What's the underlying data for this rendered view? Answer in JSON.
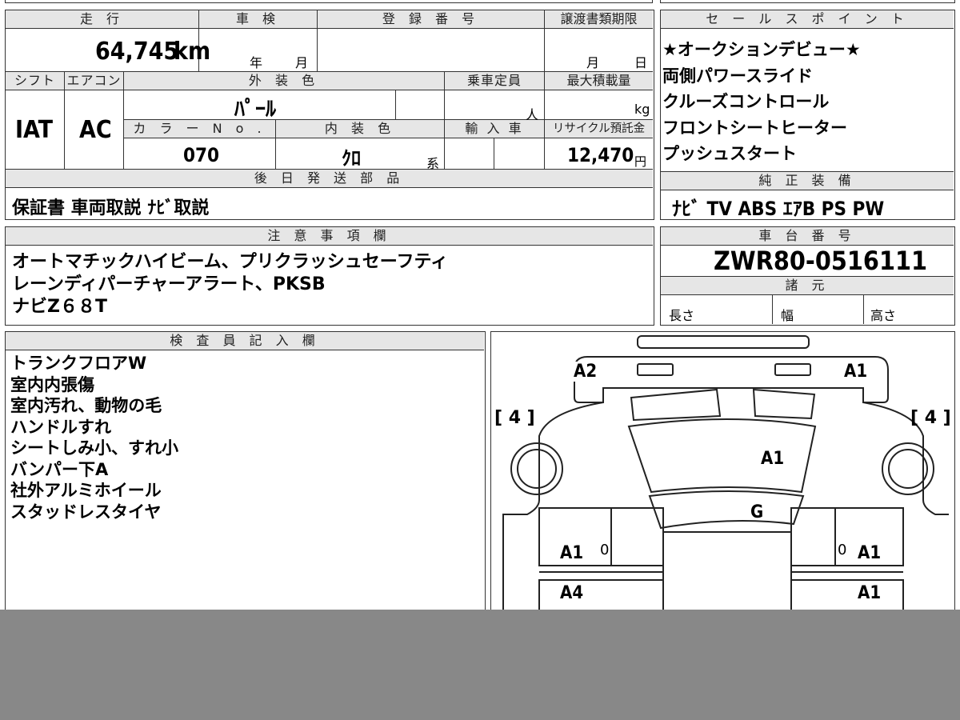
{
  "mileage": {
    "header": "走 行",
    "value": "64,745",
    "unit": "km"
  },
  "inspection": {
    "header": "車 検",
    "year": "年",
    "month": "月"
  },
  "registration": {
    "header": "登 録 番 号"
  },
  "transfer": {
    "header": "譲渡書類期限",
    "month": "月",
    "day": "日"
  },
  "sales_points": {
    "header": "セ ー ル ス ポ イ ン ト",
    "items": [
      "★オークションデビュー★",
      "両側パワースライド",
      "クルーズコントロール",
      "フロントシートヒーター",
      "プッシュスタート"
    ]
  },
  "shift": {
    "header": "シフト",
    "value": "IAT"
  },
  "aircon": {
    "header": "エアコン",
    "value": "AC"
  },
  "exterior_color": {
    "header": "外 装 色",
    "value": "ﾊﾟｰﾙ"
  },
  "capacity": {
    "header": "乗車定員",
    "unit": "人"
  },
  "max_load": {
    "header": "最大積載量",
    "unit": "kg"
  },
  "color_no": {
    "header": "カ ラ ー N o .",
    "value": "070"
  },
  "interior_color": {
    "header": "内 装 色",
    "value": "ｸﾛ",
    "suffix": "系"
  },
  "import": {
    "header": "輸 入 車"
  },
  "recycle": {
    "header": "リサイクル預託金",
    "value": "12,470",
    "unit": "円"
  },
  "later_parts": {
    "header": "後 日 発 送 部 品",
    "value": "保証書 車両取説 ﾅﾋﾞ取説"
  },
  "genuine_equipment": {
    "header": "純 正 装 備",
    "value": "ﾅﾋﾞ TV ABS ｴｱB PS PW"
  },
  "notes": {
    "header": "注 意 事 項 欄",
    "lines": [
      "オートマチックハイビーム、プリクラッシュセーフティ",
      "レーンディパーチャーアラート、PKSB",
      "ナビZ６８T"
    ]
  },
  "chassis": {
    "header": "車 台 番 号",
    "value": "ZWR80-0516111"
  },
  "specs": {
    "header": "諸 元",
    "length": "長さ",
    "width": "幅",
    "height": "高さ"
  },
  "inspector": {
    "header": "検 査 員 記 入 欄",
    "lines": [
      "トランクフロアW",
      "室内内張傷",
      "室内汚れ、動物の毛",
      "ハンドルすれ",
      "シートしみ小、すれ小",
      "バンパー下A",
      "社外アルミホイール",
      "スタッドレスタイヤ"
    ]
  },
  "diagram": {
    "a2": "A2",
    "a1_tl": "A1",
    "tire_left": "[ 4 ]",
    "tire_right": "[ 4 ]",
    "a1_hood": "A1",
    "g_glass": "G",
    "a1_left": "A1",
    "zero_left": "0",
    "zero_right": "0",
    "a1_right": "A1",
    "a4_left": "A4",
    "a1_right2": "A1"
  }
}
